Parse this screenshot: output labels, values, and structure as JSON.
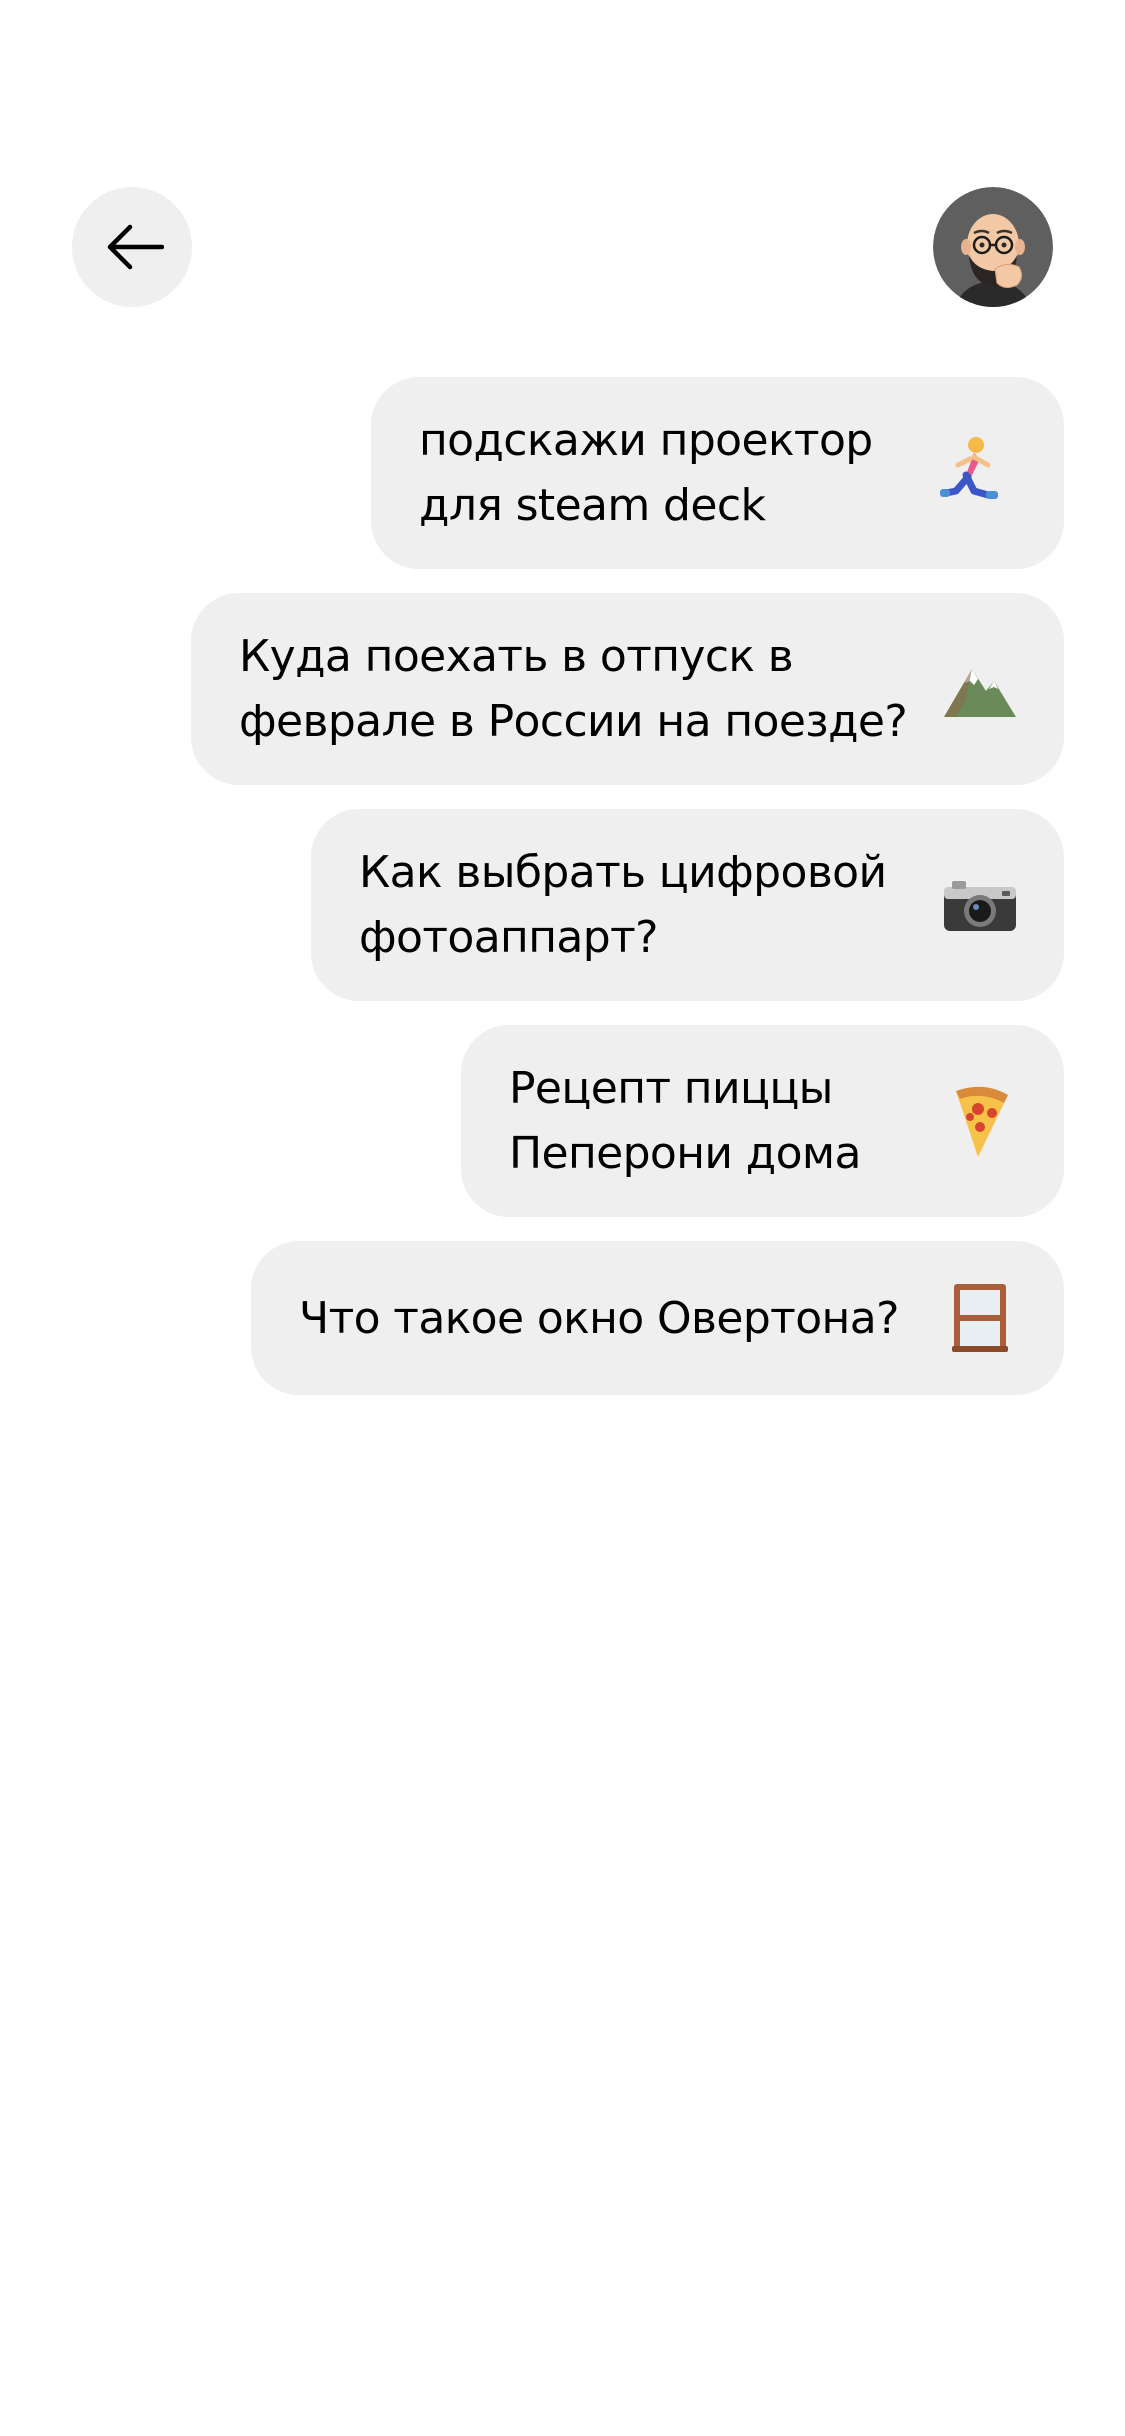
{
  "header": {
    "back_icon": "arrow-left-icon",
    "avatar_icon": "memoji-avatar"
  },
  "suggestions": [
    {
      "lines": [
        "подскажи проектор",
        "для steam deck"
      ],
      "emoji": "running-person-icon"
    },
    {
      "lines": [
        "Куда поехать в отпуск в",
        "феврале в России на поезде?"
      ],
      "emoji": "mountain-icon"
    },
    {
      "lines": [
        "Как выбрать цифровой",
        "фотоаппарт?"
      ],
      "emoji": "camera-icon"
    },
    {
      "lines": [
        "Рецепт пиццы",
        "Пеперони дома"
      ],
      "emoji": "pizza-icon"
    },
    {
      "lines": [
        "Что такое окно Овертона?"
      ],
      "emoji": "window-icon"
    }
  ],
  "colors": {
    "bubble_bg": "#efefef",
    "text": "#000000",
    "page_bg": "#ffffff"
  }
}
